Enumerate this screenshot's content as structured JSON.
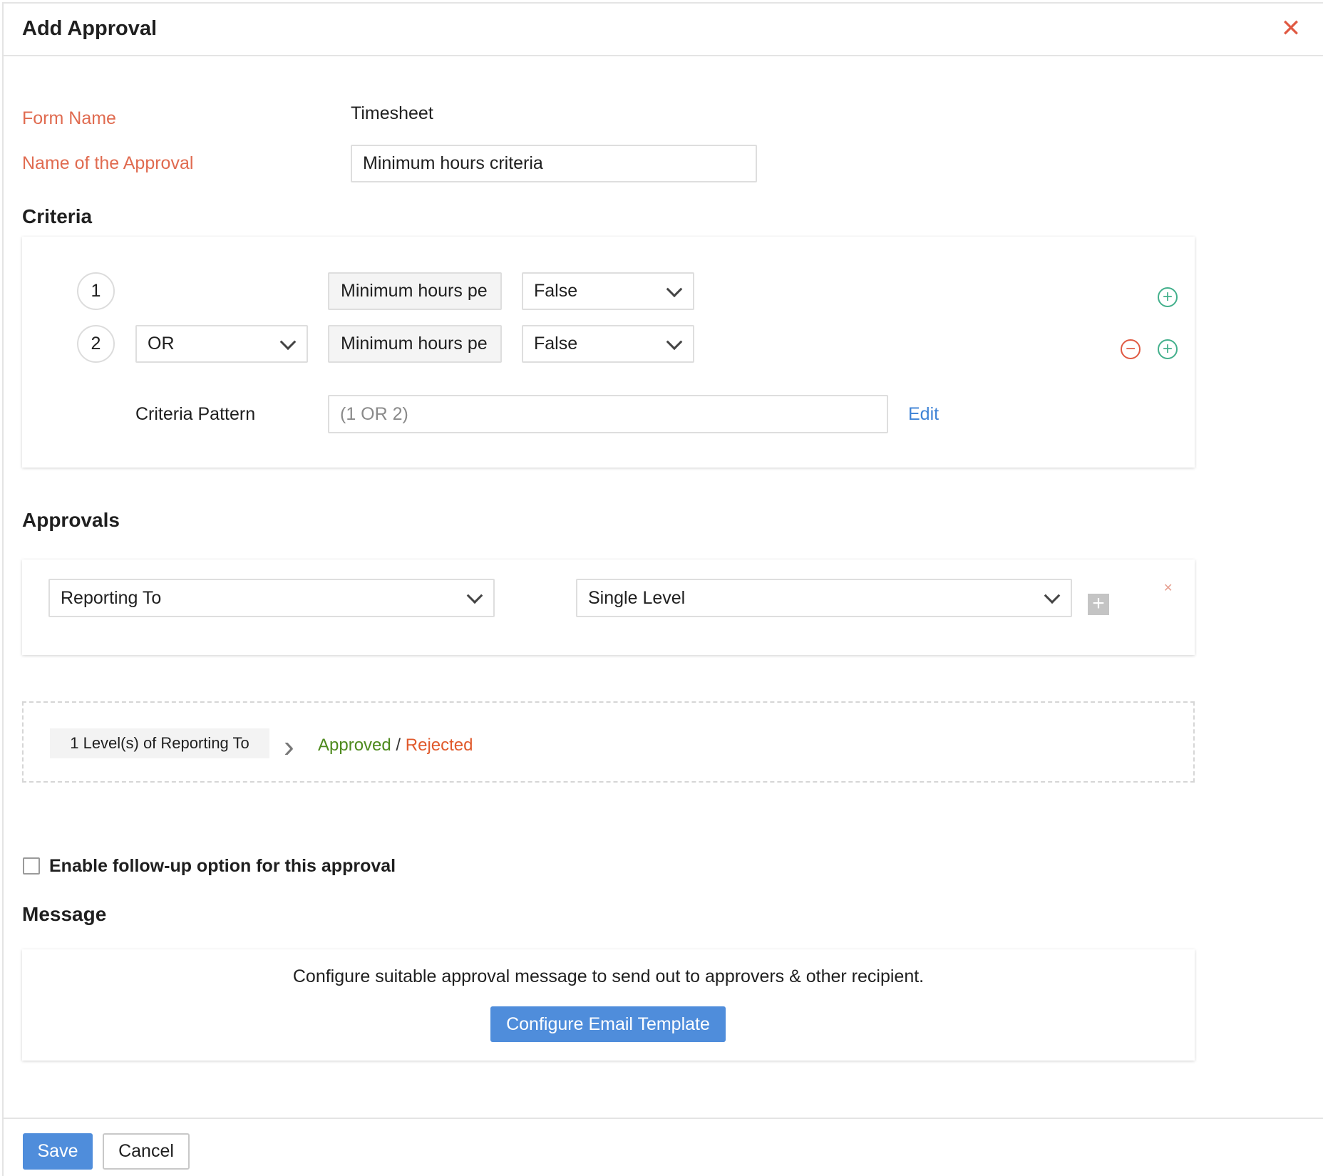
{
  "dialog": {
    "title": "Add Approval",
    "close_icon": "close-icon"
  },
  "form": {
    "form_name_label": "Form Name",
    "form_name_value": "Timesheet",
    "approval_name_label": "Name of the Approval",
    "approval_name_value": "Minimum hours criteria"
  },
  "criteria": {
    "heading": "Criteria",
    "rows": [
      {
        "number": "1",
        "operator": "",
        "field": "Minimum hours pe",
        "value": "False"
      },
      {
        "number": "2",
        "operator": "OR",
        "field": "Minimum hours pe",
        "value": "False"
      }
    ],
    "pattern_label": "Criteria Pattern",
    "pattern_value": "(1 OR 2)",
    "edit_label": "Edit"
  },
  "approvals": {
    "heading": "Approvals",
    "approver_select": "Reporting To",
    "level_select": "Single Level",
    "flow_level_text": "1 Level(s) of Reporting To",
    "approved_label": "Approved",
    "separator": " / ",
    "rejected_label": "Rejected"
  },
  "followup": {
    "checked": false,
    "label": "Enable follow-up option for this approval"
  },
  "message": {
    "heading": "Message",
    "description": "Configure suitable approval message to send out to approvers & other recipient.",
    "button_label": "Configure Email Template"
  },
  "footer": {
    "save_label": "Save",
    "cancel_label": "Cancel"
  },
  "colors": {
    "accent_blue": "#4f8ddb",
    "label_red": "#e06b50",
    "approved_green": "#4e8a1e",
    "rejected_red": "#e05a2c",
    "add_green": "#43b08c"
  }
}
